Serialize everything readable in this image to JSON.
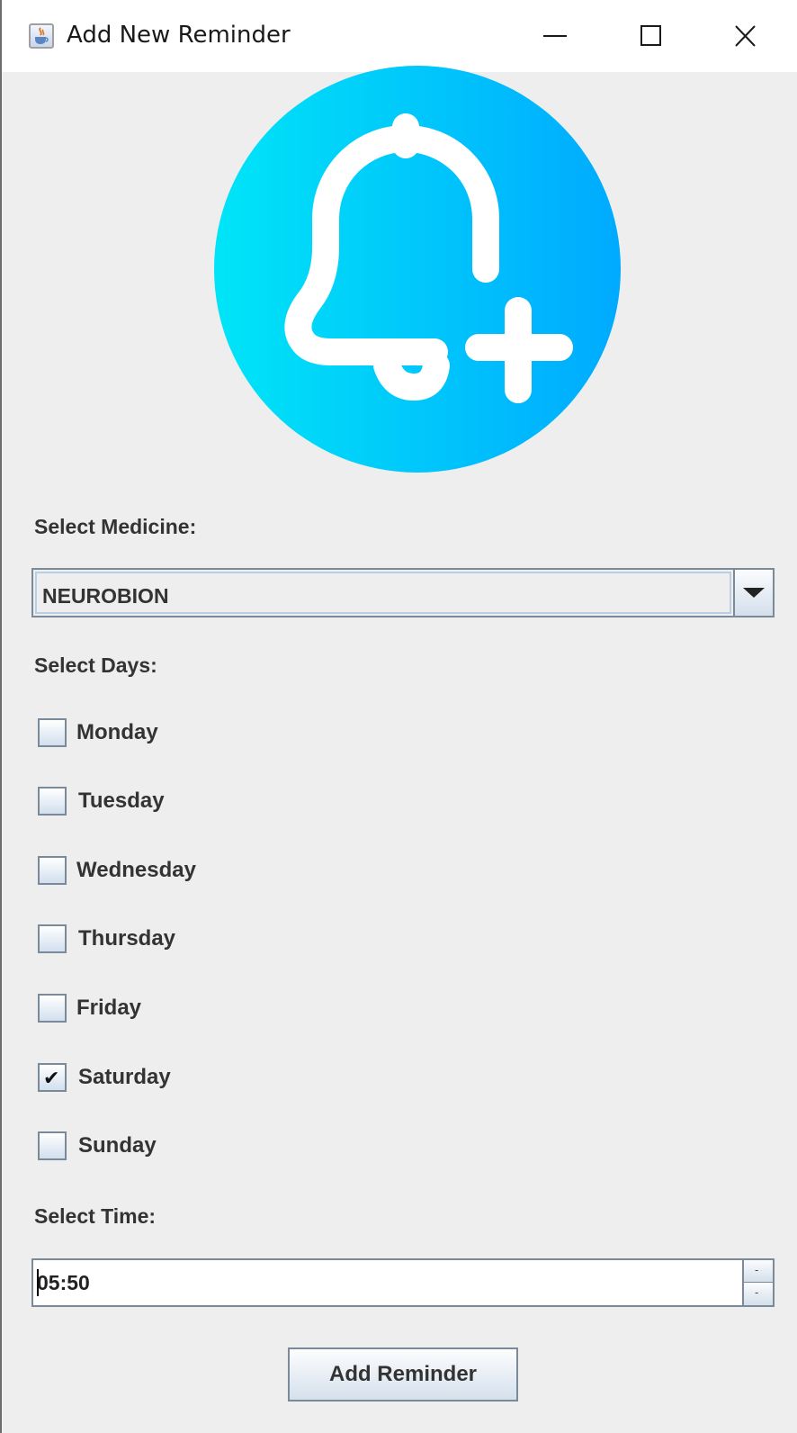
{
  "window": {
    "title": "Add New Reminder",
    "controls": [
      "minimize-icon",
      "maximize-icon",
      "close-icon"
    ]
  },
  "logo": {
    "icon": "bell-plus-icon",
    "gradient_start": "#00e5f7",
    "gradient_end": "#00aaff"
  },
  "medicine": {
    "label": "Select Medicine:",
    "selected": "NEUROBION"
  },
  "days": {
    "label": "Select Days:",
    "items": [
      {
        "label": "Monday",
        "checked": false
      },
      {
        "label": "Tuesday",
        "checked": false
      },
      {
        "label": "Wednesday",
        "checked": false
      },
      {
        "label": "Thursday",
        "checked": false
      },
      {
        "label": "Friday",
        "checked": false
      },
      {
        "label": "Saturday",
        "checked": true
      },
      {
        "label": "Sunday",
        "checked": false
      }
    ]
  },
  "time": {
    "label": "Select Time:",
    "value": "05:50",
    "up_symbol": "-",
    "down_symbol": "-"
  },
  "actions": {
    "add_label": "Add Reminder"
  }
}
